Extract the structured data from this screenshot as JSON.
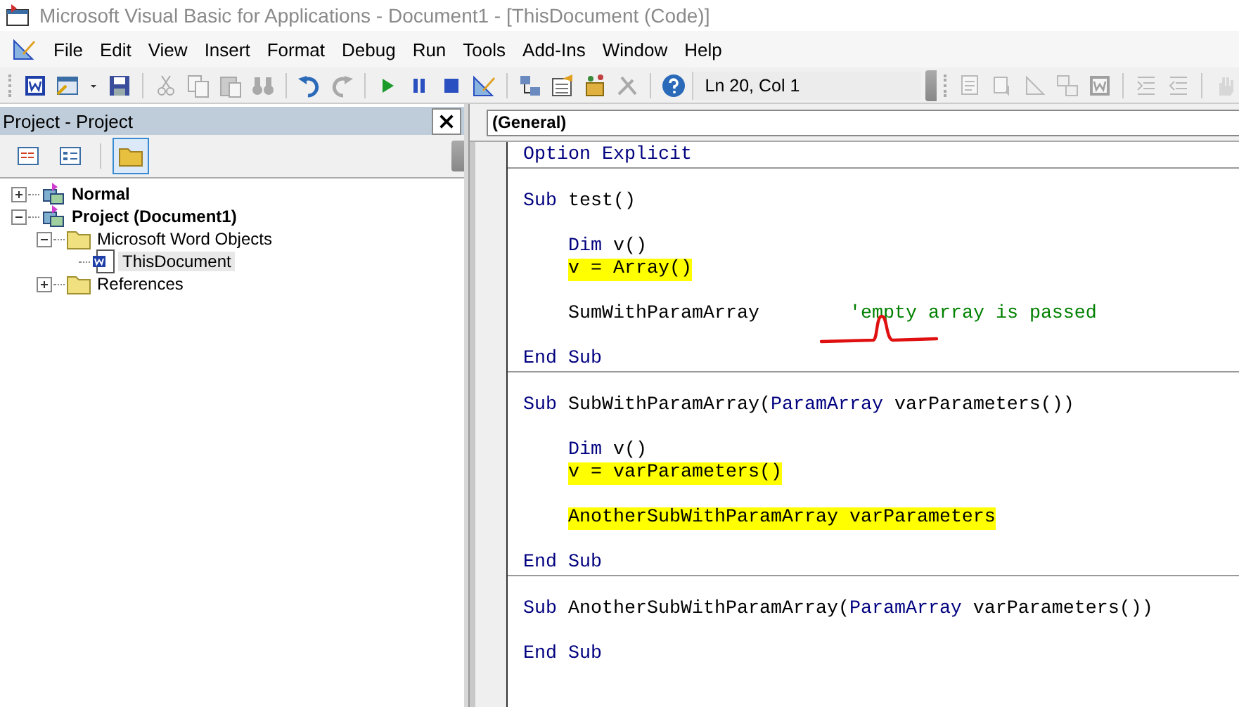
{
  "window": {
    "title": "Microsoft Visual Basic for Applications - Document1 - [ThisDocument (Code)]"
  },
  "menu": [
    {
      "label": "File"
    },
    {
      "label": "Edit"
    },
    {
      "label": "View"
    },
    {
      "label": "Insert"
    },
    {
      "label": "Format"
    },
    {
      "label": "Debug"
    },
    {
      "label": "Run"
    },
    {
      "label": "Tools"
    },
    {
      "label": "Add-Ins"
    },
    {
      "label": "Window"
    },
    {
      "label": "Help"
    }
  ],
  "toolbar": {
    "buttons": [
      {
        "kind": "word",
        "disabled": false
      },
      {
        "kind": "form",
        "disabled": false
      },
      {
        "kind": "caret",
        "disabled": false
      },
      {
        "kind": "save",
        "disabled": false
      },
      {
        "kind": "sep"
      },
      {
        "kind": "cut",
        "disabled": true
      },
      {
        "kind": "copy",
        "disabled": true
      },
      {
        "kind": "paste",
        "disabled": true
      },
      {
        "kind": "find",
        "disabled": true
      },
      {
        "kind": "sep"
      },
      {
        "kind": "undo",
        "disabled": false
      },
      {
        "kind": "redo",
        "disabled": true
      },
      {
        "kind": "sep"
      },
      {
        "kind": "run",
        "disabled": false
      },
      {
        "kind": "pause",
        "disabled": false
      },
      {
        "kind": "stop",
        "disabled": false
      },
      {
        "kind": "design",
        "disabled": false
      },
      {
        "kind": "sep"
      },
      {
        "kind": "explorer",
        "disabled": false
      },
      {
        "kind": "properties",
        "disabled": false
      },
      {
        "kind": "browser",
        "disabled": false
      },
      {
        "kind": "toolbox",
        "disabled": true
      },
      {
        "kind": "sep"
      },
      {
        "kind": "help",
        "disabled": false
      }
    ],
    "position": "Ln 20, Col 1",
    "edit_buttons": [
      {
        "kind": "list",
        "disabled": true
      },
      {
        "kind": "constants",
        "disabled": true
      },
      {
        "kind": "info",
        "disabled": true
      },
      {
        "kind": "params",
        "disabled": true
      },
      {
        "kind": "word",
        "disabled": true
      },
      {
        "kind": "sep"
      },
      {
        "kind": "indent",
        "disabled": true
      },
      {
        "kind": "outdent",
        "disabled": true
      },
      {
        "kind": "sep"
      },
      {
        "kind": "hand",
        "disabled": true
      }
    ]
  },
  "project": {
    "title": "Project - Project",
    "view_buttons": [
      {
        "kind": "code",
        "selected": false
      },
      {
        "kind": "object",
        "selected": false
      },
      {
        "kind": "folders",
        "selected": true
      }
    ],
    "tree": [
      {
        "label": "Normal",
        "kind": "project",
        "bold": true,
        "expanded": false,
        "selected": false
      },
      {
        "label": "Project (Document1)",
        "kind": "project",
        "bold": true,
        "expanded": true,
        "selected": false,
        "children": [
          {
            "label": "Microsoft Word Objects",
            "kind": "folder",
            "bold": false,
            "expanded": true,
            "selected": false,
            "children": [
              {
                "label": "ThisDocument",
                "kind": "document",
                "bold": false,
                "selected": true
              }
            ]
          },
          {
            "label": "References",
            "kind": "folder",
            "bold": false,
            "expanded": false,
            "selected": false
          }
        ]
      }
    ]
  },
  "code": {
    "object": "(General)",
    "procedures": [
      {
        "lines": [
          {
            "kind": "code",
            "highlighted": false,
            "tokens": [
              {
                "kind": "keyword",
                "text": "Option Explicit"
              }
            ]
          }
        ]
      },
      {
        "lines": [
          {
            "kind": "blank"
          },
          {
            "kind": "code",
            "highlighted": false,
            "tokens": [
              {
                "kind": "keyword",
                "text": "Sub"
              },
              {
                "kind": "plain",
                "text": " test()"
              }
            ],
            "children": [
              {
                "kind": "blank"
              },
              {
                "kind": "code",
                "highlighted": false,
                "tokens": [
                  {
                    "kind": "keyword",
                    "text": "Dim"
                  },
                  {
                    "kind": "plain",
                    "text": " v()"
                  }
                ]
              },
              {
                "kind": "code",
                "highlighted": true,
                "tokens": [
                  {
                    "kind": "plain",
                    "text": "v = Array()"
                  }
                ]
              },
              {
                "kind": "blank"
              },
              {
                "kind": "code",
                "highlighted": false,
                "squiggle": true,
                "tokens": [
                  {
                    "kind": "plain",
                    "text": "SumWithParamArray        "
                  },
                  {
                    "kind": "comment",
                    "text": "'empty array is passed"
                  }
                ]
              },
              {
                "kind": "blank"
              }
            ]
          },
          {
            "kind": "code",
            "highlighted": false,
            "tokens": [
              {
                "kind": "keyword",
                "text": "End Sub"
              }
            ]
          }
        ]
      },
      {
        "lines": [
          {
            "kind": "blank"
          },
          {
            "kind": "code",
            "highlighted": false,
            "tokens": [
              {
                "kind": "keyword",
                "text": "Sub"
              },
              {
                "kind": "plain",
                "text": " SubWithParamArray("
              },
              {
                "kind": "keyword",
                "text": "ParamArray"
              },
              {
                "kind": "plain",
                "text": " varParameters())"
              }
            ],
            "children": [
              {
                "kind": "blank"
              },
              {
                "kind": "code",
                "highlighted": false,
                "tokens": [
                  {
                    "kind": "keyword",
                    "text": "Dim"
                  },
                  {
                    "kind": "plain",
                    "text": " v()"
                  }
                ]
              },
              {
                "kind": "code",
                "highlighted": true,
                "tokens": [
                  {
                    "kind": "plain",
                    "text": "v = varParameters()"
                  }
                ]
              },
              {
                "kind": "blank"
              },
              {
                "kind": "code",
                "highlighted": true,
                "tokens": [
                  {
                    "kind": "plain",
                    "text": "AnotherSubWithParamArray varParameters"
                  }
                ]
              },
              {
                "kind": "blank"
              }
            ]
          },
          {
            "kind": "code",
            "highlighted": false,
            "tokens": [
              {
                "kind": "keyword",
                "text": "End Sub"
              }
            ]
          }
        ]
      },
      {
        "lines": [
          {
            "kind": "blank"
          },
          {
            "kind": "code",
            "highlighted": false,
            "tokens": [
              {
                "kind": "keyword",
                "text": "Sub"
              },
              {
                "kind": "plain",
                "text": " AnotherSubWithParamArray("
              },
              {
                "kind": "keyword",
                "text": "ParamArray"
              },
              {
                "kind": "plain",
                "text": " varParameters())"
              }
            ],
            "children": [
              {
                "kind": "blank"
              }
            ]
          },
          {
            "kind": "code",
            "highlighted": false,
            "tokens": [
              {
                "kind": "keyword",
                "text": "End Sub"
              }
            ]
          }
        ]
      }
    ]
  }
}
